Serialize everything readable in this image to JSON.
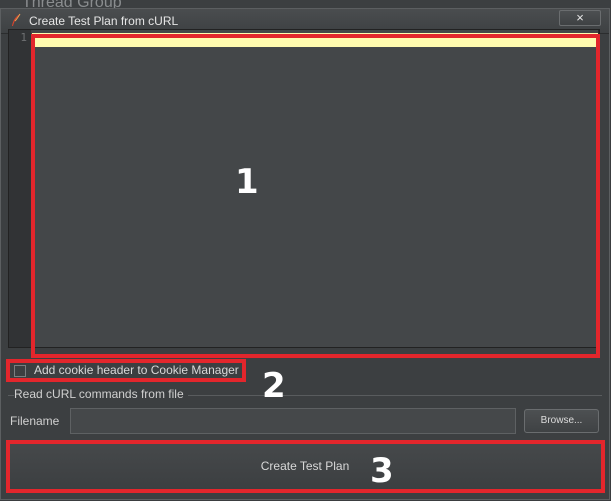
{
  "background": {
    "title": "Thread Group"
  },
  "window": {
    "title": "Create Test Plan from cURL",
    "close_icon": "×"
  },
  "editor": {
    "line_numbers": [
      "1"
    ],
    "content": ""
  },
  "options": {
    "cookie_label": "Add cookie header to Cookie Manager",
    "cookie_checked": false
  },
  "file_section": {
    "title": "Read cURL commands from file",
    "filename_label": "Filename",
    "filename_value": "",
    "browse_label": "Browse..."
  },
  "actions": {
    "create_label": "Create Test Plan"
  },
  "annotations": {
    "marker_1": "1",
    "marker_2": "2",
    "marker_3": "3",
    "highlight_color": "#e3262c"
  },
  "colors": {
    "current_line": "#fffbaf",
    "editor_bg": "#444749",
    "dialog_bg": "#3c3f41"
  }
}
